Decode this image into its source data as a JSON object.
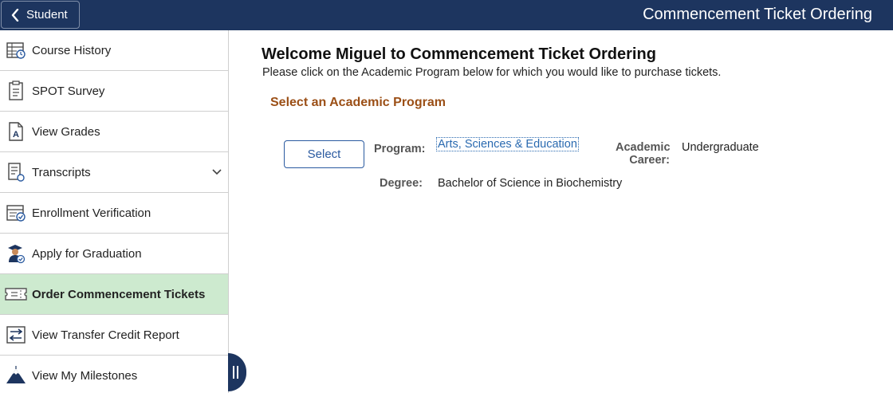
{
  "header": {
    "back_label": "Student",
    "title": "Commencement Ticket Ordering"
  },
  "sidebar": {
    "items": [
      {
        "label": "Course History",
        "icon": "course-history-icon",
        "active": false
      },
      {
        "label": "SPOT Survey",
        "icon": "clipboard-icon",
        "active": false
      },
      {
        "label": "View Grades",
        "icon": "grade-document-icon",
        "active": false
      },
      {
        "label": "Transcripts",
        "icon": "transcript-icon",
        "active": false,
        "expandable": true
      },
      {
        "label": "Enrollment Verification",
        "icon": "enrollment-verification-icon",
        "active": false
      },
      {
        "label": "Apply for Graduation",
        "icon": "graduate-icon",
        "active": false
      },
      {
        "label": "Order Commencement Tickets",
        "icon": "ticket-icon",
        "active": true
      },
      {
        "label": "View Transfer Credit Report",
        "icon": "transfer-arrows-icon",
        "active": false
      },
      {
        "label": "View My Milestones",
        "icon": "mountain-icon",
        "active": false
      }
    ]
  },
  "main": {
    "welcome": "Welcome Miguel to Commencement Ticket Ordering",
    "instructions": "Please click on the Academic Program below for which you would like to purchase tickets.",
    "section_title": "Select an Academic Program",
    "select_label": "Select",
    "program_label": "Program:",
    "program_value": "Arts, Sciences & Education",
    "career_label_line1": "Academic",
    "career_label_line2": "Career:",
    "career_value": "Undergraduate",
    "degree_label": "Degree:",
    "degree_value": "Bachelor of Science in Biochemistry"
  },
  "colors": {
    "header_bg": "#1d355f",
    "active_item_bg": "#cdeacf",
    "section_title": "#9b4f16",
    "link": "#2a6ab0"
  }
}
